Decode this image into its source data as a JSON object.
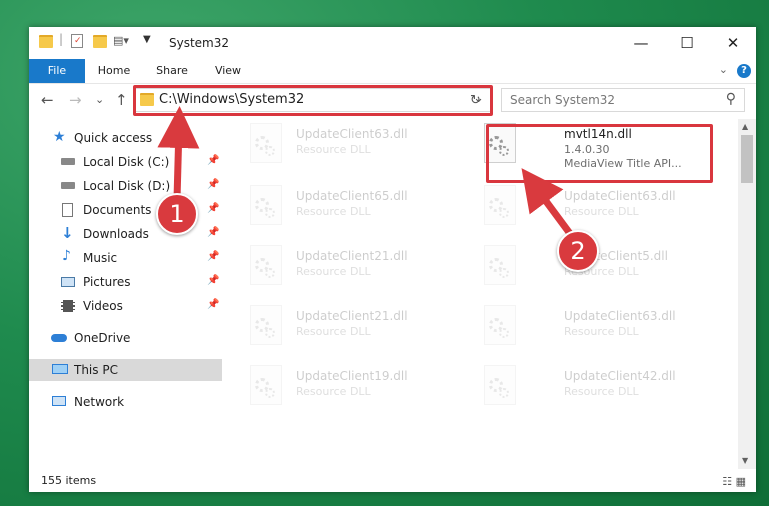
{
  "window": {
    "title": "System32",
    "minimize": "—",
    "maximize": "☐",
    "close": "✕"
  },
  "ribbon": {
    "tabs": [
      "File",
      "Home",
      "Share",
      "View"
    ],
    "help": "?",
    "expand": "⌄"
  },
  "address": {
    "path": "C:\\Windows\\System32",
    "dropdown": "⌄",
    "refresh": "↻"
  },
  "search": {
    "placeholder": "Search System32",
    "icon": "⚲"
  },
  "nav": {
    "back": "←",
    "forward": "→",
    "recent": "⌄",
    "up": "↑"
  },
  "sidebar": {
    "items": [
      {
        "label": "Quick access",
        "icon": "star-icon"
      },
      {
        "label": "Local Disk (C:)",
        "icon": "drive-icon",
        "pinned": true
      },
      {
        "label": "Local Disk (D:)",
        "icon": "drive-icon",
        "pinned": true
      },
      {
        "label": "Documents",
        "icon": "documents-icon",
        "pinned": true
      },
      {
        "label": "Downloads",
        "icon": "download-icon",
        "pinned": true
      },
      {
        "label": "Music",
        "icon": "music-icon",
        "pinned": true
      },
      {
        "label": "Pictures",
        "icon": "pictures-icon",
        "pinned": true
      },
      {
        "label": "Videos",
        "icon": "videos-icon",
        "pinned": true
      },
      {
        "label": "OneDrive",
        "icon": "cloud-icon"
      },
      {
        "label": "This PC",
        "icon": "computer-icon",
        "selected": true
      },
      {
        "label": "Network",
        "icon": "network-icon"
      }
    ]
  },
  "files": {
    "highlighted": {
      "name": "mvtl14n.dll",
      "version": "1.4.0.30",
      "description": "MediaView Title API..."
    },
    "left_column": [
      {
        "name": "UpdateClient63.dll",
        "type": "Resource DLL"
      },
      {
        "name": "UpdateClient65.dll",
        "type": "Resource DLL"
      },
      {
        "name": "UpdateClient21.dll",
        "type": "Resource DLL"
      },
      {
        "name": "UpdateClient21.dll",
        "type": "Resource DLL"
      },
      {
        "name": "UpdateClient19.dll",
        "type": "Resource DLL"
      }
    ],
    "right_column": [
      {
        "name": "UpdateClient63.dll",
        "type": "Resource DLL"
      },
      {
        "name": "UpdateClient5.dll",
        "type": "Resource DLL"
      },
      {
        "name": "UpdateClient63.dll",
        "type": "Resource DLL"
      },
      {
        "name": "UpdateClient42.dll",
        "type": "Resource DLL"
      }
    ]
  },
  "status": {
    "count": "155 items",
    "views": "☷ ▦"
  },
  "annotations": {
    "step1": "1",
    "step2": "2"
  },
  "colors": {
    "accent": "#1979ca",
    "highlight_red": "#d9363e",
    "background_green": "#1f8b4e"
  }
}
